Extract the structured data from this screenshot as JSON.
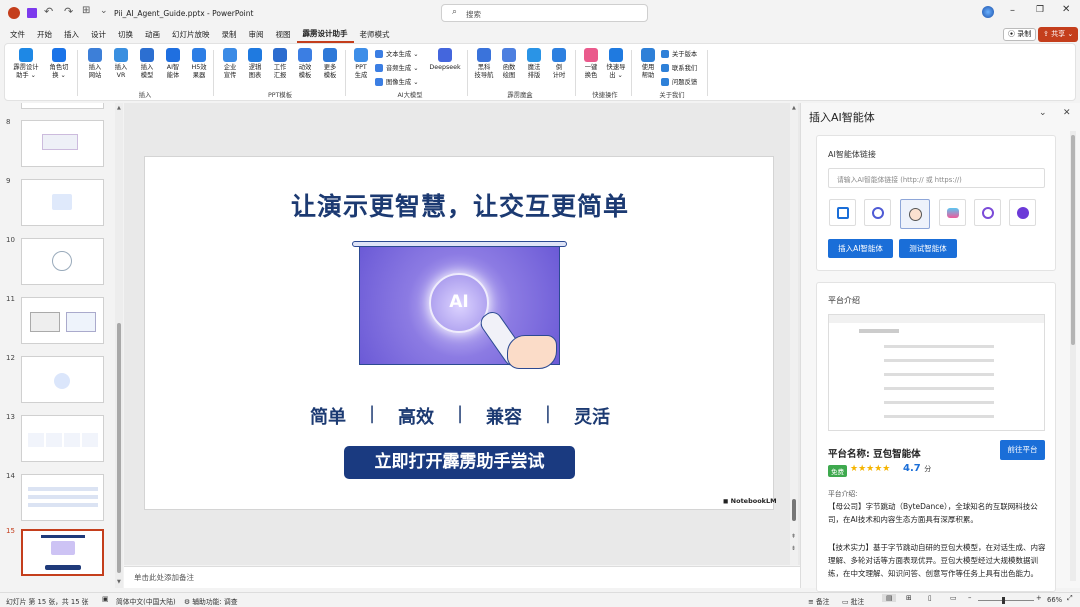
{
  "window": {
    "filename": "Pii_AI_Agent_Guide.pptx",
    "separator": "-",
    "app": "PowerPoint",
    "search_placeholder": "搜索"
  },
  "menu": {
    "tabs": [
      "文件",
      "开始",
      "插入",
      "设计",
      "切换",
      "动画",
      "幻灯片放映",
      "录制",
      "审阅",
      "视图",
      "霹雳设计助手",
      "老师模式"
    ],
    "active": "霹雳设计助手",
    "record": "录制",
    "share": "共享"
  },
  "ribbon": {
    "buttons": [
      {
        "label": "霹雳设计\n助手 ⌄",
        "color": "#1e88e5"
      },
      {
        "label": "角色切\n换 ⌄",
        "color": "#1a73e8"
      },
      {
        "label": "插入\n网站",
        "color": "#3d7fd8"
      },
      {
        "label": "插入\nVR",
        "color": "#3a8fe0"
      },
      {
        "label": "插入\n模型",
        "color": "#2c6fd1"
      },
      {
        "label": "AI智\n能体",
        "color": "#1f6fe0"
      },
      {
        "label": "H5效\n果器",
        "color": "#2d7ee5"
      },
      {
        "label": "企业\n宣传",
        "color": "#3b8be6"
      },
      {
        "label": "逻辑\n图表",
        "color": "#1f7ae0"
      },
      {
        "label": "工作\n汇报",
        "color": "#2b6ccf"
      },
      {
        "label": "动效\n模板",
        "color": "#3b7ee3"
      },
      {
        "label": "更多\n模板",
        "color": "#2f79d8"
      },
      {
        "label": "PPT\n生成",
        "color": "#3e8ee8"
      },
      {
        "label": "Deepseek",
        "color": "#4466dd"
      },
      {
        "label": "黑科\n技导航",
        "color": "#3a73db"
      },
      {
        "label": "函数\n绘图",
        "color": "#4c7fe0"
      },
      {
        "label": "魔法\n排版",
        "color": "#2a94e6"
      },
      {
        "label": "倒\n计时",
        "color": "#2d80e0"
      },
      {
        "label": "一键\n换色",
        "color": "#ea5a8c"
      },
      {
        "label": "快速导\n出 ⌄",
        "color": "#1f7ae0"
      },
      {
        "label": "使用\n帮助",
        "color": "#2e80d8"
      }
    ],
    "small_items": [
      "文本生成 ⌄",
      "音频生成 ⌄",
      "图像生成 ⌄",
      "关于版本",
      "联系我们",
      "问题反馈"
    ],
    "groups": [
      "插入",
      "PPT模板",
      "AI大模型",
      "霹雳魔盒",
      "快捷操作",
      "关于我们"
    ]
  },
  "thumbnails": {
    "numbers": [
      "8",
      "9",
      "10",
      "11",
      "12",
      "13",
      "14",
      "15"
    ],
    "selected": "15"
  },
  "slide": {
    "title": "让演示更智慧，让交互更简单",
    "ai_badge": "AI",
    "features": [
      "简单",
      "|",
      "高效",
      "|",
      "兼容",
      "|",
      "灵活"
    ],
    "cta": "立即打开霹雳助手尝试",
    "watermark": "NotebookLM"
  },
  "notes": {
    "placeholder": "单击此处添加备注"
  },
  "panel": {
    "title": "插入AI智能体",
    "link_section": {
      "heading": "AI智能体链接",
      "placeholder": "请输入AI智能体链接 (http:// 或 https://)",
      "insert": "插入AI智能体",
      "test": "测试智能体"
    },
    "platform": {
      "heading": "平台介绍",
      "name_label": "平台名称:",
      "name": "豆包智能体",
      "goto": "前往平台",
      "free_badge": "免费",
      "stars": "★★★★★",
      "rating": "4.7",
      "rating_unit": "分",
      "intro_label": "平台介绍:",
      "para1": "【母公司】字节跳动（ByteDance），全球知名的互联网科技公司，在AI技术和内容生态方面具有深厚积累。",
      "para2": "【技术实力】基于字节跳动自研的豆包大模型，在对话生成、内容理解、多轮对话等方面表现优异。豆包大模型经过大规模数据训练，在中文理解、知识问答、创意写作等任务上具有出色能力。"
    }
  },
  "status": {
    "slide_info": "幻灯片 第 15 张，共 15 张",
    "language": "简体中文(中国大陆)",
    "accessibility": "辅助功能: 调查",
    "notes": "备注",
    "comments": "批注",
    "zoom": "66%"
  }
}
